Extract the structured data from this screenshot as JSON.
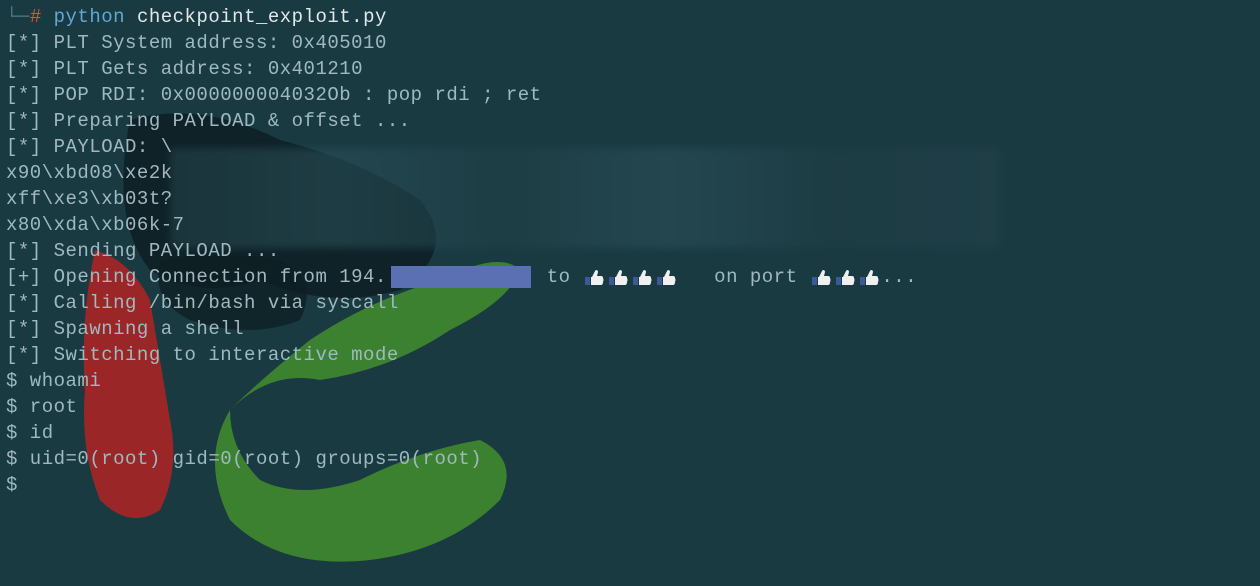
{
  "prompt": {
    "dash": "└─",
    "hash": "#",
    "python": "python",
    "script": "checkpoint_exploit.py"
  },
  "lines": {
    "l1": "[*] PLT System address: 0x405010",
    "l2": "[*] PLT Gets address: 0x401210",
    "l3": "[*] POP RDI: 0x000000004032Ob : pop rdi ; ret",
    "l4": "[*] Preparing PAYLOAD & offset ...",
    "l5": "[*] PAYLOAD: \\",
    "l6": "x90\\xbd08\\xe2k",
    "l7": "xff\\xe3\\xb03t?",
    "l8": "x80\\xda\\xb06k-7",
    "l9": "[*] Sending PAYLOAD ...",
    "l10a": "[+] Opening Connection from 194.",
    "l10b": " to ",
    "l10c": "   on port ",
    "l10d": "...",
    "l11": "[*] Calling /bin/bash via syscall",
    "l12": "[*] Spawning a shell",
    "l13": "[*] Switching to interactive mode",
    "l14": "$ whoami",
    "l15": "$ root",
    "l16": "$ id",
    "l17": "$ uid=0(root) gid=0(root) groups=0(root)",
    "l18": "$"
  }
}
